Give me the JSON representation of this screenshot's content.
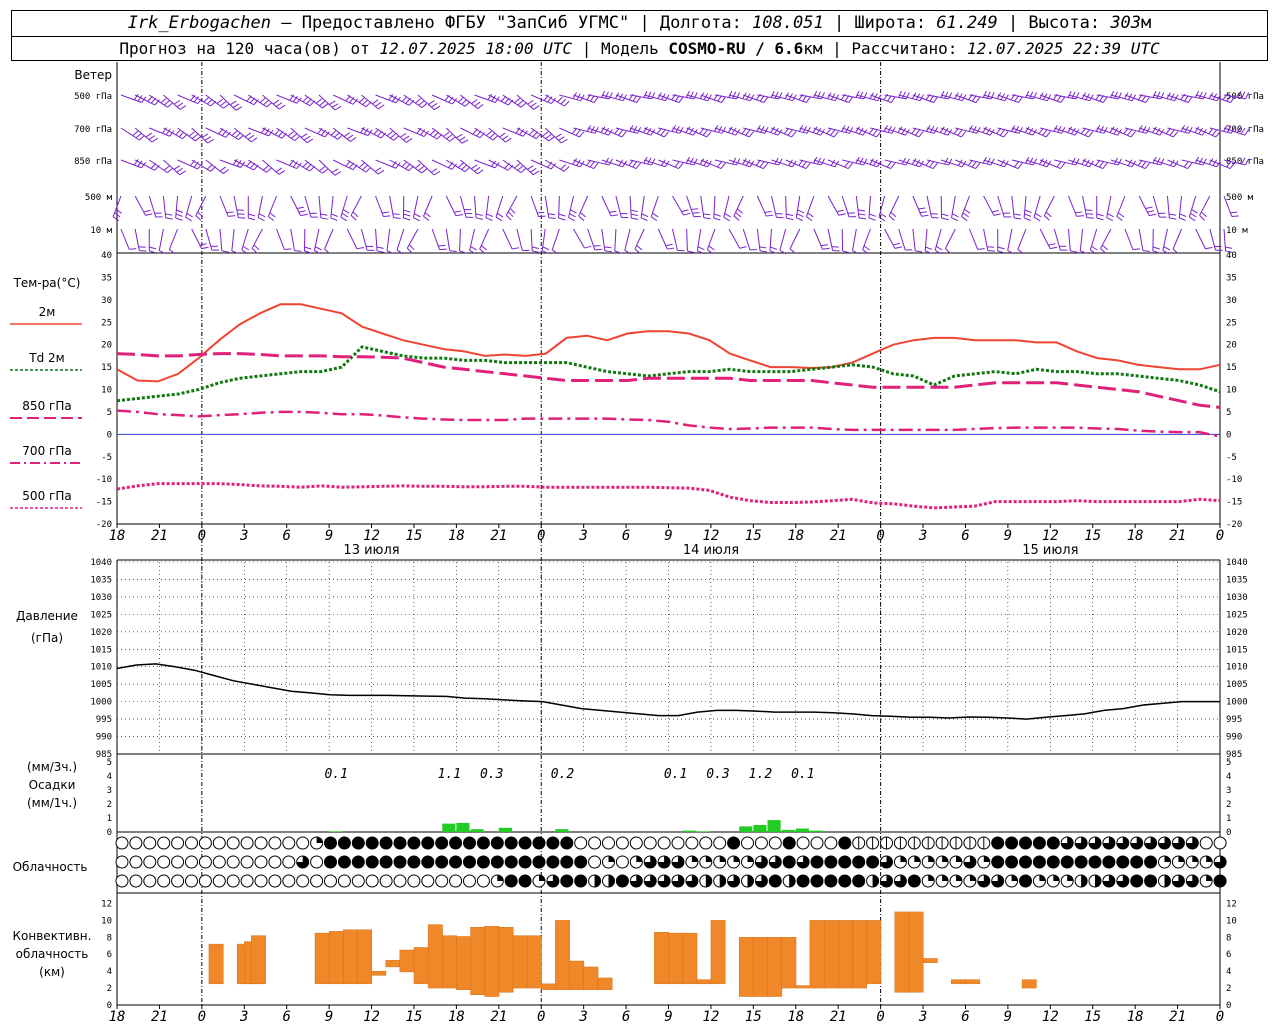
{
  "header": {
    "station": "Irk_Erbogachen",
    "provider": " – Предоставлено ФГБУ \"ЗапСиб УГМС\" | Долгота: ",
    "lon": "108.051",
    "lat_label": " | Широта: ",
    "lat": "61.249",
    "alt_label": " | Высота: ",
    "alt": "303",
    "alt_unit": "м",
    "fc_label": "Прогноз на 120 часа(ов) от ",
    "fc_start": "12.07.2025 18:00 UTC",
    "model_label": "  | Модель ",
    "model": "COSMO-RU / 6.6",
    "model_unit": "км",
    "calc_label": " | Рассчитано: ",
    "calc_time": "12.07.2025 22:39 UTC"
  },
  "labels": {
    "wind": "Ветер",
    "wind_levels": [
      "500 гПа",
      "700 гПа",
      "850 гПа",
      "500 м",
      "10 м"
    ],
    "temp_title": "Тем-ра(°С)",
    "legend": [
      {
        "label": "2м",
        "color": "#ee4433",
        "style": "solid"
      },
      {
        "label": "Td  2м",
        "color": "#117711",
        "style": "dotted"
      },
      {
        "label": "850 гПа",
        "color": "#e0207a",
        "style": "dash"
      },
      {
        "label": "700 гПа",
        "color": "#e0207a",
        "style": "dashdot"
      },
      {
        "label": "500 гПа",
        "color": "#e0207a",
        "style": "dot"
      }
    ],
    "pressure": [
      "Давление",
      "(гПа)"
    ],
    "precip": [
      "(мм/3ч.)",
      "Осадки",
      "(мм/1ч.)"
    ],
    "cloud": "Облачность",
    "conv": [
      "Конвективн.",
      "облачность",
      "(км)"
    ],
    "days": [
      "13 июля",
      "14 июля",
      "15 июля"
    ]
  },
  "colors": {
    "t2m": "#ee4433",
    "td2m": "#117711",
    "t850": "#e0207a",
    "t700": "#e0207a",
    "t500": "#e0207a",
    "pressure": "#000000",
    "wind": "#7a22cc",
    "precip": "#22cc22",
    "conv": "#f0882a",
    "zero_line": "#3344cc"
  },
  "chart_data": {
    "type": "line",
    "x_hours_utc": {
      "start": 18,
      "end_after_days": "16 июля 00",
      "step_ticks": 3
    },
    "x_tick_labels": [
      "18",
      "21",
      "0",
      "3",
      "6",
      "9",
      "12",
      "15",
      "18",
      "21",
      "0",
      "3",
      "6",
      "9",
      "12",
      "15",
      "18",
      "21",
      "0",
      "3",
      "6",
      "9",
      "12",
      "15",
      "18",
      "21",
      "0"
    ],
    "temperature": {
      "ylim": [
        -20,
        40
      ],
      "yticks": [
        40,
        35,
        30,
        25,
        20,
        15,
        10,
        5,
        0,
        -5,
        -10,
        -15,
        -20
      ],
      "series": [
        {
          "name": "2м",
          "values": [
            14.5,
            12,
            11.8,
            13.5,
            17,
            21,
            24.5,
            27,
            29,
            29,
            28,
            27,
            24,
            22.5,
            21,
            20,
            19,
            18.5,
            17.5,
            17.8,
            17.5,
            18,
            21.5,
            22,
            21,
            22.5,
            23,
            23,
            22.5,
            21,
            18,
            16.5,
            15,
            15,
            14.8,
            15,
            16,
            18,
            20,
            21,
            21.5,
            21.5,
            21,
            21,
            21,
            20.5,
            20.5,
            18.5,
            17,
            16.5,
            15.5,
            15,
            14.5,
            14.5,
            15.5
          ]
        },
        {
          "name": "Td  2м",
          "values": [
            7.5,
            8,
            8.5,
            9,
            10,
            11.5,
            12.5,
            13,
            13.5,
            14,
            14,
            15,
            19.5,
            18.5,
            17.5,
            17,
            17,
            16.5,
            16.5,
            16,
            16,
            16,
            16,
            15,
            14,
            13.5,
            13,
            13.5,
            14,
            14,
            14.5,
            14,
            14,
            14,
            14.5,
            15,
            15.5,
            15,
            13.5,
            13,
            11,
            13,
            13.5,
            14,
            13.5,
            14.5,
            14,
            14,
            13.5,
            13.5,
            13,
            12.5,
            12,
            11,
            9.5
          ]
        },
        {
          "name": "850 гПа",
          "values": [
            18,
            17.8,
            17.5,
            17.5,
            17.8,
            18,
            18,
            17.8,
            17.5,
            17.5,
            17.5,
            17.3,
            17.3,
            17.2,
            17,
            16,
            15,
            14.5,
            14,
            13.5,
            13,
            12.5,
            12,
            12,
            12,
            12,
            12.5,
            12.5,
            12.5,
            12.5,
            12.5,
            12,
            12,
            12,
            12,
            11.5,
            11,
            10.5,
            10.5,
            10.5,
            10.5,
            10.5,
            11,
            11.5,
            11.5,
            11.5,
            11.5,
            11,
            10.5,
            10,
            9.5,
            8.5,
            7.5,
            6.5,
            6
          ]
        },
        {
          "name": "700 гПа",
          "values": [
            5.3,
            5,
            4.5,
            4.3,
            4,
            4.3,
            4.5,
            4.8,
            5,
            5,
            4.8,
            4.5,
            4.5,
            4.2,
            3.8,
            3.5,
            3.3,
            3.2,
            3.2,
            3.2,
            3.5,
            3.5,
            3.5,
            3.5,
            3.5,
            3.3,
            3.2,
            2.8,
            2,
            1.5,
            1.2,
            1.3,
            1.5,
            1.5,
            1.5,
            1.2,
            1,
            1,
            1,
            1,
            1,
            1,
            1.2,
            1.4,
            1.5,
            1.5,
            1.5,
            1.5,
            1.3,
            1.2,
            0.8,
            0.6,
            0.5,
            0.5,
            -0.5
          ]
        },
        {
          "name": "500 гПа",
          "values": [
            -12.2,
            -11.5,
            -11,
            -11,
            -11,
            -11,
            -11.2,
            -11.5,
            -11.6,
            -11.8,
            -11.5,
            -11.8,
            -11.7,
            -11.6,
            -11.5,
            -11.6,
            -11.6,
            -11.7,
            -11.7,
            -11.6,
            -11.6,
            -11.8,
            -11.8,
            -11.8,
            -11.8,
            -11.8,
            -11.8,
            -11.9,
            -12,
            -12.5,
            -14,
            -14.8,
            -15.2,
            -15.2,
            -15.1,
            -14.8,
            -14.5,
            -15.3,
            -15.5,
            -16,
            -16.4,
            -16.2,
            -16,
            -15,
            -15,
            -15,
            -15,
            -14.8,
            -15,
            -15,
            -15,
            -15,
            -15,
            -14.5,
            -14.8
          ]
        }
      ]
    },
    "pressure": {
      "ylim": [
        985,
        1040
      ],
      "yticks": [
        1040,
        1035,
        1030,
        1025,
        1020,
        1015,
        1010,
        1005,
        1000,
        995,
        990,
        985
      ],
      "values": [
        1009.5,
        1010.5,
        1010.8,
        1010,
        1009,
        1007.5,
        1006,
        1005,
        1004,
        1003,
        1002.5,
        1002,
        1001.8,
        1001.8,
        1001.8,
        1001.7,
        1001.6,
        1001.5,
        1001,
        1000.8,
        1000.5,
        1000.2,
        1000,
        999,
        998,
        997.5,
        997,
        996.5,
        996,
        996,
        997,
        997.5,
        997.5,
        997.3,
        997,
        997,
        997,
        996.8,
        996.5,
        996,
        995.8,
        995.5,
        995.5,
        995.3,
        995.6,
        995.5,
        995.3,
        995,
        995.5,
        996,
        996.5,
        997.5,
        998,
        999,
        999.5,
        1000,
        1000,
        1000
      ]
    },
    "precip": {
      "ylim": [
        0,
        5
      ],
      "yticks": [
        5,
        4,
        3,
        2,
        1,
        0
      ],
      "sum_labels": [
        {
          "hour": 15.5,
          "text": "0.1"
        },
        {
          "hour": 23.5,
          "text": "1.1"
        },
        {
          "hour": 26.5,
          "text": "0.3"
        },
        {
          "hour": 31.5,
          "text": "0.2"
        },
        {
          "hour": 39.5,
          "text": "0.1"
        },
        {
          "hour": 42.5,
          "text": "0.3"
        },
        {
          "hour": 45.5,
          "text": "1.2"
        },
        {
          "hour": 48.5,
          "text": "0.1"
        }
      ],
      "hourly": [
        {
          "hour": 15,
          "mm": 0.05
        },
        {
          "hour": 23,
          "mm": 0.6
        },
        {
          "hour": 24,
          "mm": 0.65
        },
        {
          "hour": 25,
          "mm": 0.2
        },
        {
          "hour": 27,
          "mm": 0.3
        },
        {
          "hour": 31,
          "mm": 0.2
        },
        {
          "hour": 40,
          "mm": 0.1
        },
        {
          "hour": 41,
          "mm": 0.05
        },
        {
          "hour": 44,
          "mm": 0.4
        },
        {
          "hour": 45,
          "mm": 0.5
        },
        {
          "hour": 46,
          "mm": 0.85
        },
        {
          "hour": 47,
          "mm": 0.15
        },
        {
          "hour": 48,
          "mm": 0.25
        },
        {
          "hour": 49,
          "mm": 0.1
        }
      ]
    },
    "cloud_rows": [
      "00000000000000ABBBBBBBBBBBBBBBBBB00000000000B000B000BFFFFFFFFFFBBBBBCCCCCCCCCC000CCBAAC",
      "0000000000000C0BBBBBBBBBBBBBBBBBBB0A0ACCCAAAAACCBCBBBBBCAAAAACABBBBBBBBBBBBAAAACCCBBBAB",
      "000000000000000000000000000ABBACBBDDBCCCCCDDCDCBDBBBBBDCCBAAAACCABAAADDCCBBDCCABCBDBBB"
    ],
    "convective_cloud_km": [
      {
        "hour": 7,
        "base": 2.5,
        "top": 7.2
      },
      {
        "hour": 9,
        "base": 2.5,
        "top": 7.2
      },
      {
        "hour": 9.5,
        "base": 2.5,
        "top": 7.5
      },
      {
        "hour": 10,
        "base": 2.5,
        "top": 8.2
      },
      {
        "hour": 14.5,
        "base": 2.5,
        "top": 8.5
      },
      {
        "hour": 15.5,
        "base": 2.5,
        "top": 8.7
      },
      {
        "hour": 16.5,
        "base": 2.5,
        "top": 8.9
      },
      {
        "hour": 17.5,
        "base": 2.5,
        "top": 8.9
      },
      {
        "hour": 18.5,
        "base": 3.5,
        "top": 4.0
      },
      {
        "hour": 19.5,
        "base": 4.5,
        "top": 5.3
      },
      {
        "hour": 20.5,
        "base": 3.9,
        "top": 6.5
      },
      {
        "hour": 21.5,
        "base": 2.5,
        "top": 6.8
      },
      {
        "hour": 22.5,
        "base": 2.0,
        "top": 9.5
      },
      {
        "hour": 23.5,
        "base": 2.0,
        "top": 8.2
      },
      {
        "hour": 24.5,
        "base": 1.8,
        "top": 8.1
      },
      {
        "hour": 25.5,
        "base": 1.2,
        "top": 9.2
      },
      {
        "hour": 26.5,
        "base": 1.0,
        "top": 9.3
      },
      {
        "hour": 27.5,
        "base": 1.5,
        "top": 9.2
      },
      {
        "hour": 28.5,
        "base": 2.0,
        "top": 8.2
      },
      {
        "hour": 29.5,
        "base": 2.0,
        "top": 8.2
      },
      {
        "hour": 30.5,
        "base": 1.8,
        "top": 2.5
      },
      {
        "hour": 31.5,
        "base": 1.8,
        "top": 10.0
      },
      {
        "hour": 32.5,
        "base": 1.8,
        "top": 5.2
      },
      {
        "hour": 33.5,
        "base": 1.8,
        "top": 4.5
      },
      {
        "hour": 34.5,
        "base": 1.8,
        "top": 3.2
      },
      {
        "hour": 38.5,
        "base": 2.5,
        "top": 8.6
      },
      {
        "hour": 39.5,
        "base": 2.5,
        "top": 8.5
      },
      {
        "hour": 40.5,
        "base": 2.5,
        "top": 8.5
      },
      {
        "hour": 41.5,
        "base": 2.5,
        "top": 3.0
      },
      {
        "hour": 42.5,
        "base": 2.5,
        "top": 10.0
      },
      {
        "hour": 44.5,
        "base": 1.0,
        "top": 8.0
      },
      {
        "hour": 45.5,
        "base": 1.0,
        "top": 8.0
      },
      {
        "hour": 46.5,
        "base": 1.0,
        "top": 8.0
      },
      {
        "hour": 47.5,
        "base": 2.0,
        "top": 8.0
      },
      {
        "hour": 48.5,
        "base": 2.0,
        "top": 2.3
      },
      {
        "hour": 49.5,
        "base": 2.0,
        "top": 10.0
      },
      {
        "hour": 50.5,
        "base": 2.0,
        "top": 10.0
      },
      {
        "hour": 51.5,
        "base": 2.0,
        "top": 10.0
      },
      {
        "hour": 52.5,
        "base": 2.0,
        "top": 10.0
      },
      {
        "hour": 53.5,
        "base": 2.5,
        "top": 10.0
      },
      {
        "hour": 55.5,
        "base": 1.5,
        "top": 11.0
      },
      {
        "hour": 56.5,
        "base": 1.5,
        "top": 11.0
      },
      {
        "hour": 57.5,
        "base": 5.0,
        "top": 5.5
      },
      {
        "hour": 59.5,
        "base": 2.5,
        "top": 3.0
      },
      {
        "hour": 60.5,
        "base": 2.5,
        "top": 3.0
      },
      {
        "hour": 64.5,
        "base": 2.0,
        "top": 3.0
      }
    ],
    "conv_yticks": [
      12,
      10,
      8,
      6,
      4,
      2,
      0
    ]
  }
}
